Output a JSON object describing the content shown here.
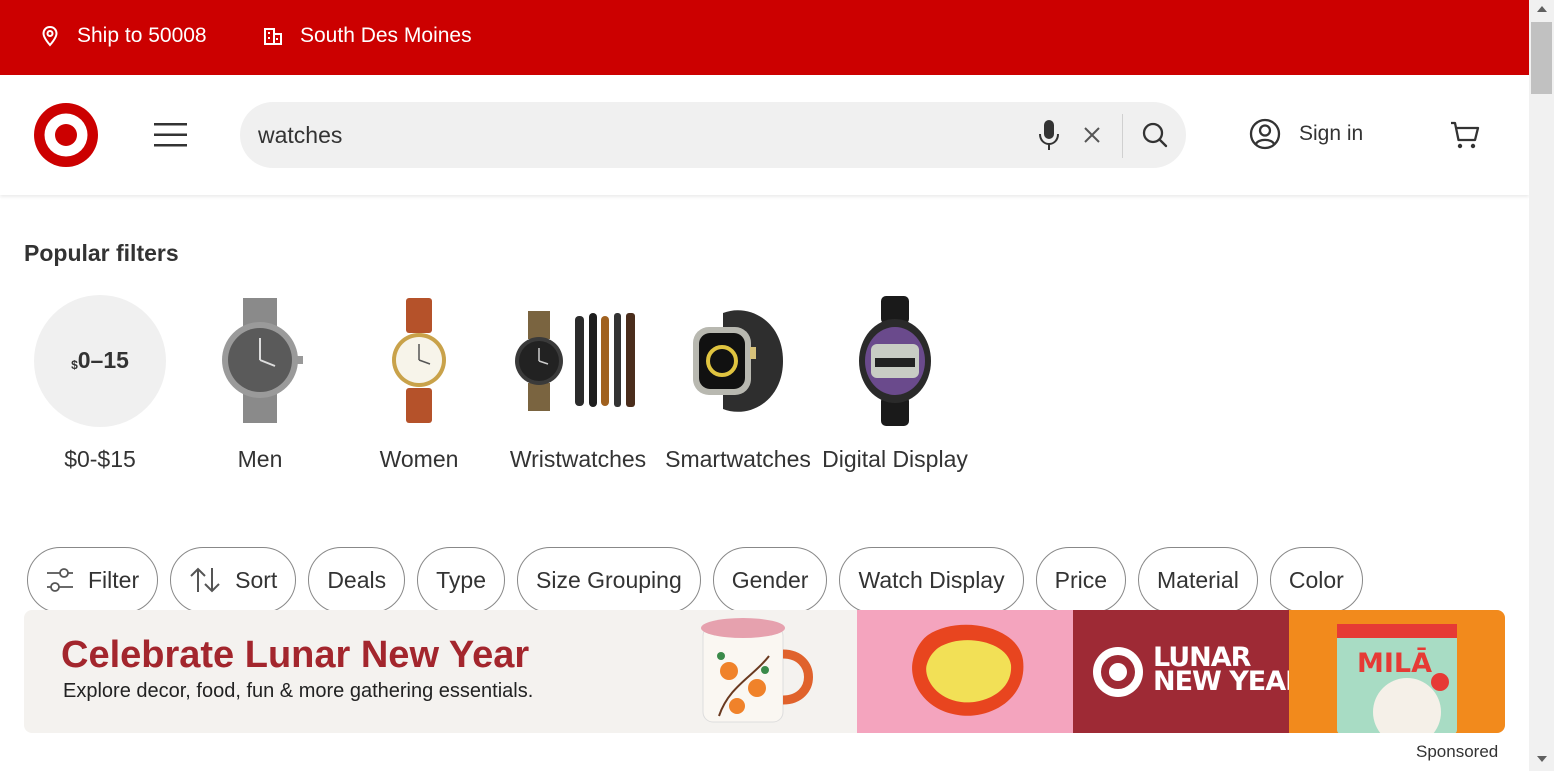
{
  "topbar": {
    "ship_label": "Ship to 50008",
    "store_label": "South Des Moines"
  },
  "header": {
    "search_value": "watches",
    "signin_label": "Sign in"
  },
  "popular_filters": {
    "title": "Popular filters",
    "price_badge": "0–15",
    "price_badge_currency": "$",
    "items": [
      {
        "label": "$0-$15"
      },
      {
        "label": "Men"
      },
      {
        "label": "Women"
      },
      {
        "label": "Wristwatches"
      },
      {
        "label": "Smartwatches"
      },
      {
        "label": "Digital Display"
      }
    ]
  },
  "chips": [
    {
      "label": "Filter",
      "icon": "sliders-icon"
    },
    {
      "label": "Sort",
      "icon": "sort-arrows-icon"
    },
    {
      "label": "Deals"
    },
    {
      "label": "Type"
    },
    {
      "label": "Size Grouping"
    },
    {
      "label": "Gender"
    },
    {
      "label": "Watch Display"
    },
    {
      "label": "Price"
    },
    {
      "label": "Material"
    },
    {
      "label": "Color"
    }
  ],
  "banner": {
    "title": "Celebrate Lunar New Year",
    "subtitle": "Explore decor, food, fun & more gathering essentials.",
    "logo_line1": "LUNAR",
    "logo_line2": "NEW YEAR",
    "product_brand": "MILĀ"
  },
  "sponsored_label": "Sponsored",
  "colors": {
    "brand_red": "#cc0000",
    "banner_title": "#a3262d"
  }
}
